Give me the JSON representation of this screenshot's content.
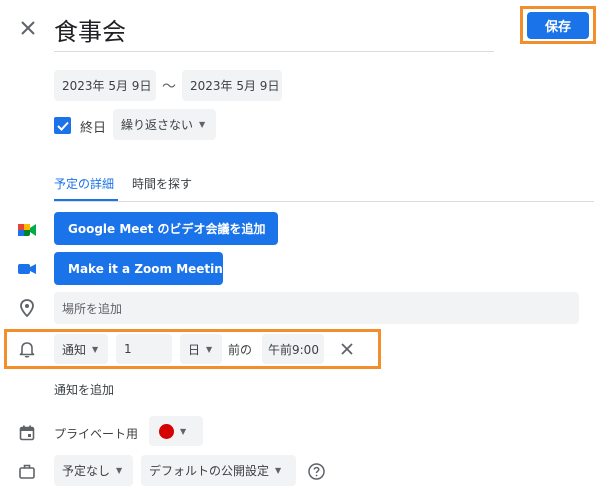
{
  "event": {
    "title": "食事会",
    "save_label": "保存",
    "start_date": "2023年 5月 9日",
    "separator": "〜",
    "end_date": "2023年 5月 9日",
    "all_day_label": "終日",
    "all_day_checked": true,
    "repeat_value": "繰り返さない"
  },
  "tabs": [
    {
      "label": "予定の詳細",
      "active": true
    },
    {
      "label": "時間を探す",
      "active": false
    }
  ],
  "conference": {
    "meet_button": "Google Meet のビデオ会議を追加",
    "zoom_button": "Make it a Zoom Meeting"
  },
  "location": {
    "placeholder": "場所を追加"
  },
  "notification": {
    "type": "通知",
    "amount": "1",
    "unit": "日",
    "before_label": "前の",
    "time": "午前9:00",
    "add_label": "通知を追加"
  },
  "calendar": {
    "name": "プライベート用",
    "color": "#d50000"
  },
  "visibility": {
    "busy_value": "予定なし",
    "visibility_value": "デフォルトの公開設定"
  },
  "colors": {
    "accent": "#1a73e8",
    "highlight": "#f28f2c"
  }
}
